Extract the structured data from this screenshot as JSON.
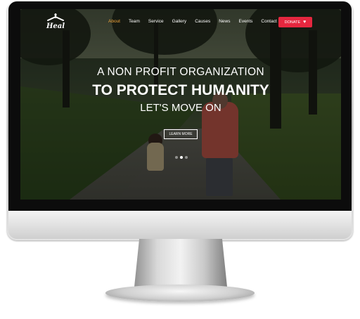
{
  "site": {
    "logo_text": "Heal",
    "logo_icon": "cross-hanger-icon"
  },
  "nav": {
    "items": [
      {
        "label": "About",
        "active": true
      },
      {
        "label": "Team",
        "active": false
      },
      {
        "label": "Service",
        "active": false
      },
      {
        "label": "Gallery",
        "active": false
      },
      {
        "label": "Causes",
        "active": false
      },
      {
        "label": "News",
        "active": false
      },
      {
        "label": "Events",
        "active": false
      },
      {
        "label": "Contact",
        "active": false
      }
    ],
    "donate_label": "DONATE",
    "donate_icon": "heart-icon"
  },
  "hero": {
    "line1": "A NON PROFIT ORGANIZATION",
    "line2": "TO PROTECT HUMANITY",
    "line3": "LET'S MOVE ON",
    "cta_label": "LEARN MORE",
    "slides_total": 3,
    "active_slide": 2
  },
  "colors": {
    "accent_active_nav": "#f0a43a",
    "donate_button": "#e5273f",
    "text": "#ffffff"
  }
}
